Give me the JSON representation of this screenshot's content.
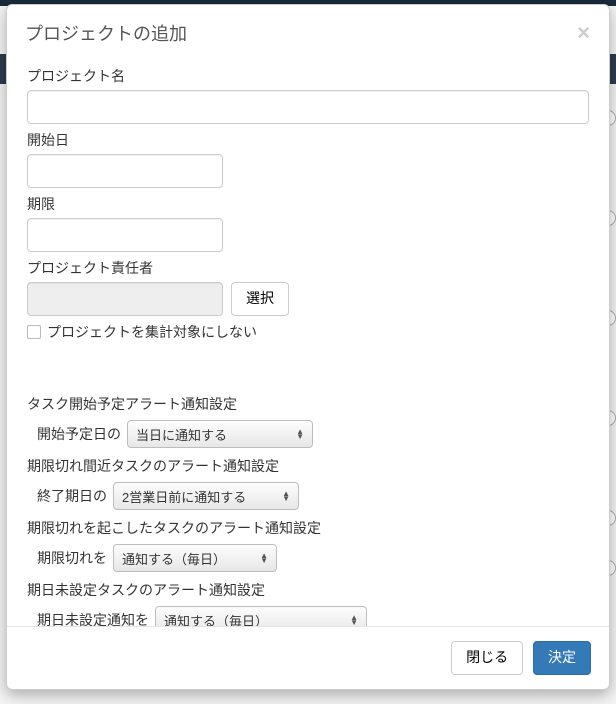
{
  "modal": {
    "title": "プロジェクトの追加"
  },
  "form": {
    "name_label": "プロジェクト名",
    "name_value": "",
    "start_label": "開始日",
    "start_value": "",
    "due_label": "期限",
    "due_value": "",
    "owner_label": "プロジェクト責任者",
    "owner_value": "",
    "owner_select_button": "選択",
    "exclude_checkbox_label": "プロジェクトを集計対象にしない"
  },
  "alerts": {
    "start_plan": {
      "heading": "タスク開始予定アラート通知設定",
      "sub_label": "開始予定日の",
      "value": "当日に通知する"
    },
    "near_due": {
      "heading": "期限切れ間近タスクのアラート通知設定",
      "sub_label": "終了期日の",
      "value": "2営業日前に通知する"
    },
    "overdue": {
      "heading": "期限切れを起こしたタスクのアラート通知設定",
      "sub_label": "期限切れを",
      "value": "通知する（毎日）"
    },
    "no_due": {
      "heading": "期日未設定タスクのアラート通知設定",
      "sub_label": "期日未設定通知を",
      "value": "通知する（毎日）"
    }
  },
  "footer": {
    "close": "閉じる",
    "submit": "決定"
  }
}
